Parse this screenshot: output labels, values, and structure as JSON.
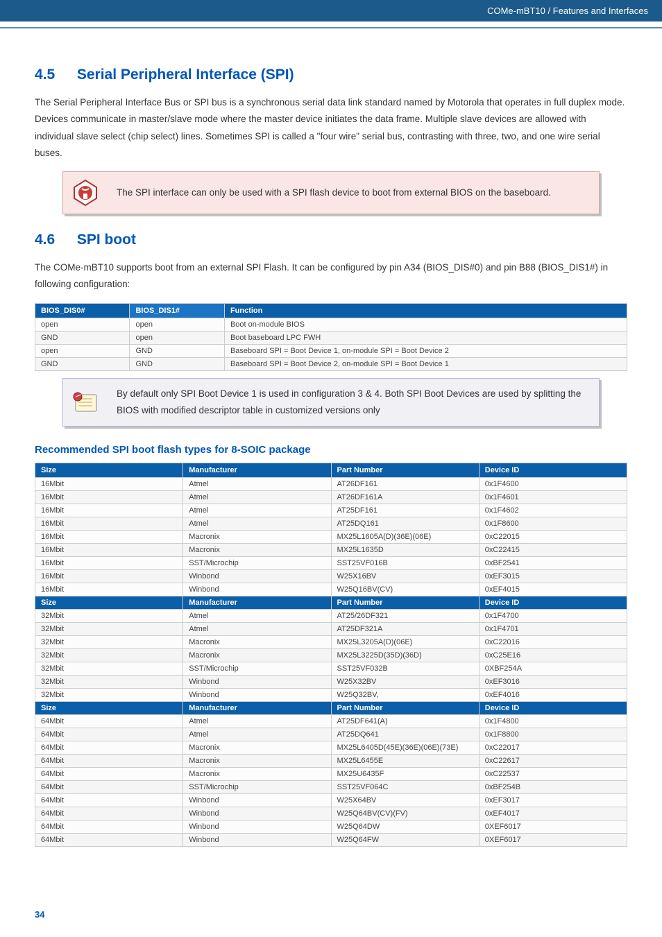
{
  "header_breadcrumb": "COMe-mBT10 / Features and Interfaces",
  "s45": {
    "num": "4.5",
    "title": "Serial Peripheral Interface (SPI)",
    "para": "The Serial Peripheral Interface Bus or SPI bus is a synchronous serial data link standard named by Motorola that operates in full duplex mode. Devices communicate in master/slave mode where the master device initiates the data frame. Multiple slave devices are allowed with individual slave select (chip select) lines. Sometimes SPI is called a \"four wire\" serial bus, contrasting with three, two, and one wire serial buses.",
    "callout": "The SPI interface can only be used with a SPI flash device to boot from external BIOS on the baseboard."
  },
  "s46": {
    "num": "4.6",
    "title": "SPI boot",
    "para": "The COMe-mBT10 supports boot from an external SPI Flash. It can be configured by pin A34 (BIOS_DIS#0) and pin B88 (BIOS_DIS1#) in following configuration:",
    "callout": "By default only SPI Boot Device 1 is used in configuration 3 & 4. Both SPI Boot Devices are used by splitting the BIOS with modified descriptor table in customized versions only"
  },
  "pin_table": {
    "headers": [
      "BIOS_DIS0#",
      "BIOS_DIS1#",
      "Function"
    ],
    "rows": [
      [
        "open",
        "open",
        "Boot on-module BIOS"
      ],
      [
        "GND",
        "open",
        "Boot baseboard LPC FWH"
      ],
      [
        "open",
        "GND",
        "Baseboard SPI = Boot Device 1, on-module SPI = Boot Device 2"
      ],
      [
        "GND",
        "GND",
        "Baseboard SPI = Boot Device 2, on-module SPI = Boot Device 1"
      ]
    ]
  },
  "flash_subheading": "Recommended SPI boot flash types for 8-SOIC package",
  "flash_headers": [
    "Size",
    "Manufacturer",
    "Part Number",
    "Device ID"
  ],
  "flash_rows": [
    {
      "t": "d",
      "c": [
        "16Mbit",
        "Atmel",
        "AT26DF161",
        "0x1F4600"
      ]
    },
    {
      "t": "d",
      "c": [
        "16Mbit",
        "Atmel",
        "AT26DF161A",
        "0x1F4601"
      ]
    },
    {
      "t": "d",
      "c": [
        "16Mbit",
        "Atmel",
        "AT25DF161",
        "0x1F4602"
      ]
    },
    {
      "t": "d",
      "c": [
        "16Mbit",
        "Atmel",
        "AT25DQ161",
        "0x1F8600"
      ]
    },
    {
      "t": "d",
      "c": [
        "16Mbit",
        "Macronix",
        "MX25L1605A(D)(36E)(06E)",
        "0xC22015"
      ]
    },
    {
      "t": "d",
      "c": [
        "16Mbit",
        "Macronix",
        "MX25L1635D",
        "0xC22415"
      ]
    },
    {
      "t": "d",
      "c": [
        "16Mbit",
        "SST/Microchip",
        "SST25VF016B",
        "0xBF2541"
      ]
    },
    {
      "t": "d",
      "c": [
        "16Mbit",
        "Winbond",
        "W25X16BV",
        "0xEF3015"
      ]
    },
    {
      "t": "d",
      "c": [
        "16Mbit",
        "Winbond",
        "W25Q16BV(CV)",
        "0xEF4015"
      ]
    },
    {
      "t": "h",
      "c": [
        "Size",
        "Manufacturer",
        "Part Number",
        "Device ID"
      ]
    },
    {
      "t": "d",
      "c": [
        "32Mbit",
        "Atmel",
        "AT25/26DF321",
        "0x1F4700"
      ]
    },
    {
      "t": "d",
      "c": [
        "32Mbit",
        "Atmel",
        "AT25DF321A",
        "0x1F4701"
      ]
    },
    {
      "t": "d",
      "c": [
        "32Mbit",
        "Macronix",
        "MX25L3205A(D)(06E)",
        "0xC22016"
      ]
    },
    {
      "t": "d",
      "c": [
        "32Mbit",
        "Macronix",
        "MX25L3225D(35D)(36D)",
        "0xC25E16"
      ]
    },
    {
      "t": "d",
      "c": [
        "32Mbit",
        "SST/Microchip",
        "SST25VF032B",
        "0XBF254A"
      ]
    },
    {
      "t": "d",
      "c": [
        "32Mbit",
        "Winbond",
        "W25X32BV",
        "0xEF3016"
      ]
    },
    {
      "t": "d",
      "c": [
        "32Mbit",
        "Winbond",
        "W25Q32BV,",
        "0xEF4016"
      ]
    },
    {
      "t": "h",
      "c": [
        "Size",
        "Manufacturer",
        "Part Number",
        "Device ID"
      ]
    },
    {
      "t": "d",
      "c": [
        "64Mbit",
        "Atmel",
        "AT25DF641(A)",
        "0x1F4800"
      ]
    },
    {
      "t": "d",
      "c": [
        "64Mbit",
        "Atmel",
        "AT25DQ641",
        "0x1F8800"
      ]
    },
    {
      "t": "d",
      "c": [
        "64Mbit",
        "Macronix",
        "MX25L6405D(45E)(36E)(06E)(73E)",
        "0xC22017"
      ]
    },
    {
      "t": "d",
      "c": [
        "64Mbit",
        "Macronix",
        "MX25L6455E",
        "0xC22617"
      ]
    },
    {
      "t": "d",
      "c": [
        "64Mbit",
        "Macronix",
        "MX25U6435F",
        "0xC22537"
      ]
    },
    {
      "t": "d",
      "c": [
        "64Mbit",
        "SST/Microchip",
        "SST25VF064C",
        "0xBF254B"
      ]
    },
    {
      "t": "d",
      "c": [
        "64Mbit",
        "Winbond",
        "W25X64BV",
        "0xEF3017"
      ]
    },
    {
      "t": "d",
      "c": [
        "64Mbit",
        "Winbond",
        "W25Q64BV(CV)(FV)",
        "0xEF4017"
      ]
    },
    {
      "t": "d",
      "c": [
        "64Mbit",
        "Winbond",
        "W25Q64DW",
        "0XEF6017"
      ]
    },
    {
      "t": "d",
      "c": [
        "64Mbit",
        "Winbond",
        "W25Q64FW",
        "0XEF6017"
      ]
    }
  ],
  "page_number": "34"
}
